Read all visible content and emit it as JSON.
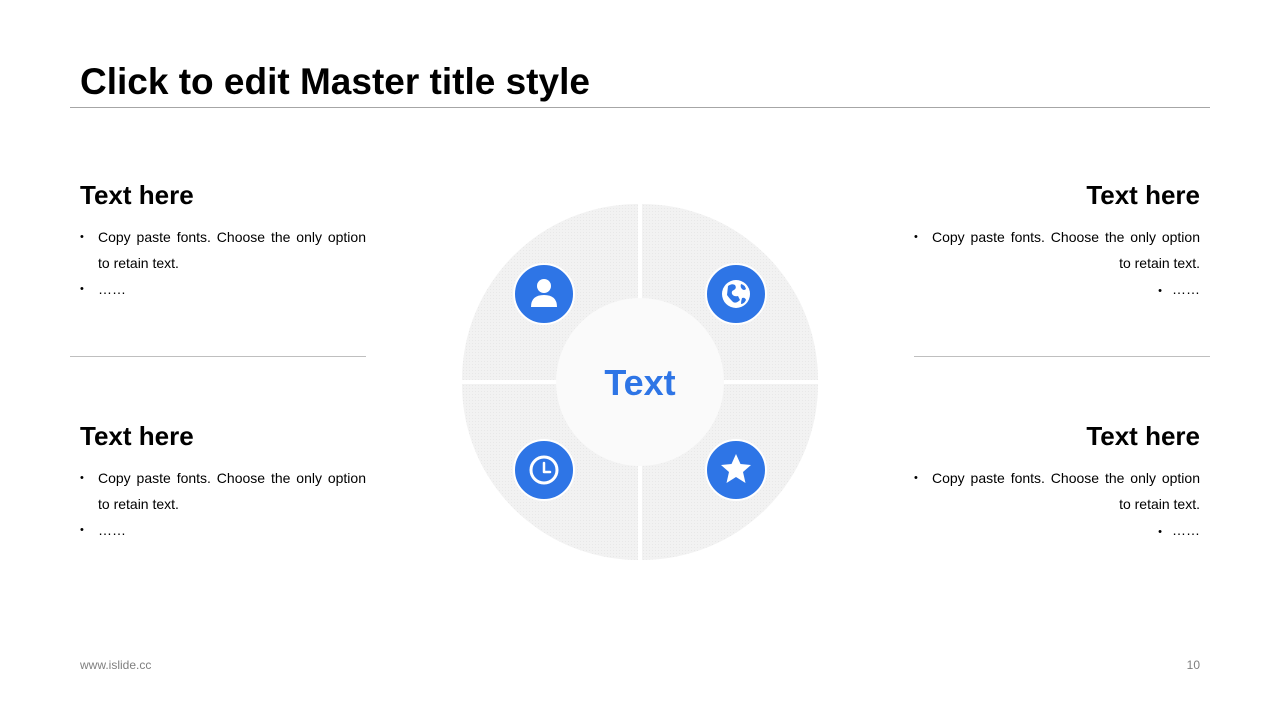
{
  "slide": {
    "title": "Click to edit Master title style",
    "footer_url": "www.islide.cc",
    "page_number": "10"
  },
  "blocks": [
    {
      "heading": "Text here",
      "bullet1_line1": "Copy paste fonts. Choose the only option",
      "bullet1_line2": "to retain text.",
      "bullet2": "……"
    },
    {
      "heading": "Text here",
      "bullet1_line1": "Copy paste fonts. Choose the only option",
      "bullet1_line2": "to retain text.",
      "bullet2": "……"
    },
    {
      "heading": "Text here",
      "bullet1_line1": "Copy paste fonts. Choose the only option",
      "bullet1_line2": "to retain text.",
      "bullet2": "……"
    },
    {
      "heading": "Text here",
      "bullet1_line1": "Copy paste fonts. Choose the only option",
      "bullet1_line2": "to retain text.",
      "bullet2": "……"
    }
  ],
  "diagram": {
    "center_label": "Text",
    "icons": [
      "user-icon",
      "globe-icon",
      "clock-icon",
      "star-icon"
    ]
  },
  "colors": {
    "accent": "#2e75e6",
    "segment_fill": "#f2f2f2",
    "center_fill": "#fafafa"
  }
}
